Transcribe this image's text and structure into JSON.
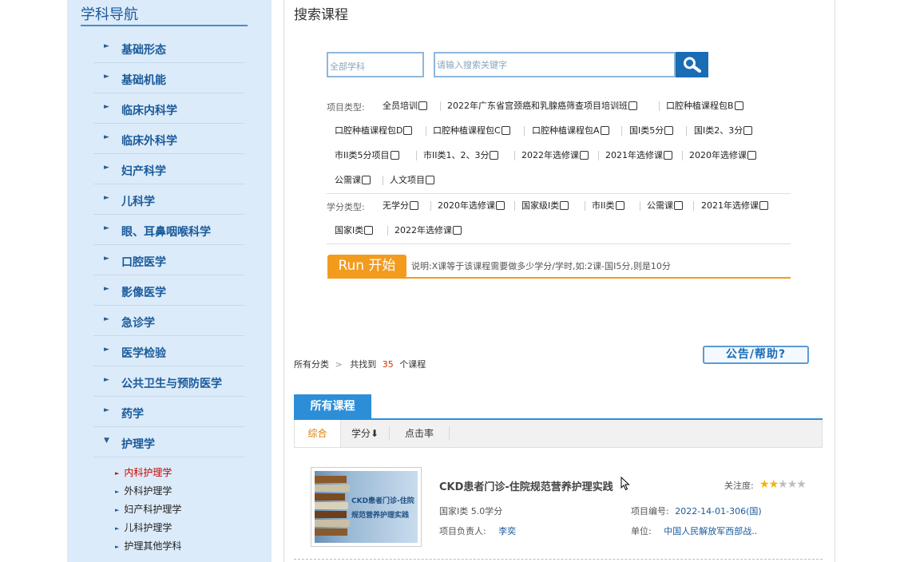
{
  "sidebar": {
    "title": "学科导航",
    "categories": [
      {
        "label": "基础形态",
        "arrow": "►"
      },
      {
        "label": "基础机能",
        "arrow": "►"
      },
      {
        "label": "临床内科学",
        "arrow": "►"
      },
      {
        "label": "临床外科学",
        "arrow": "►"
      },
      {
        "label": "妇产科学",
        "arrow": "►"
      },
      {
        "label": "儿科学",
        "arrow": "►"
      },
      {
        "label": "眼、耳鼻咽喉科学",
        "arrow": "►"
      },
      {
        "label": "口腔医学",
        "arrow": "►"
      },
      {
        "label": "影像医学",
        "arrow": "►"
      },
      {
        "label": "急诊学",
        "arrow": "►"
      },
      {
        "label": "医学检验",
        "arrow": "►"
      },
      {
        "label": "公共卫生与预防医学",
        "arrow": "►"
      },
      {
        "label": "药学",
        "arrow": "►"
      },
      {
        "label": "护理学",
        "arrow": "▼"
      }
    ],
    "subitems": [
      {
        "label": "内科护理学",
        "active": true
      },
      {
        "label": "外科护理学",
        "active": false
      },
      {
        "label": "妇产科护理学",
        "active": false
      },
      {
        "label": "儿科护理学",
        "active": false
      },
      {
        "label": "护理其他学科",
        "active": false
      }
    ],
    "sub_arrow": "►"
  },
  "search": {
    "title": "搜索课程",
    "subject_select": "全部学科",
    "placeholder": "请输入搜索关键字",
    "value": ""
  },
  "filters": {
    "project_label": "项目类型:",
    "project_options": [
      "全员培训",
      "2022年广东省宫颈癌和乳腺癌筛查项目培训班",
      "口腔种植课程包B",
      "口腔种植课程包D",
      "口腔种植课程包C",
      "口腔种植课程包A",
      "国I类5分",
      "国I类2、3分",
      "市II类5分项目",
      "市II类1、2、3分",
      "2022年选修课",
      "2021年选修课",
      "2020年选修课",
      "公需课",
      "人文项目"
    ],
    "credit_label": "学分类型:",
    "credit_options": [
      "无学分",
      "2020年选修课",
      "国家级I类",
      "市II类",
      "公需课",
      "2021年选修课",
      "国家I类",
      "2022年选修课"
    ]
  },
  "run": {
    "label": "Run 开始",
    "note": "说明:X课等于该课程需要做多少学分/学时,如:2课-国I5分,则是10分"
  },
  "results": {
    "crumb": "所有分类",
    "crumb_arrow": ">",
    "found_prefix": "共找到",
    "count": "35",
    "found_suffix": "个课程",
    "notice_button": "公告/帮助?"
  },
  "tabs": {
    "all": "所有课程",
    "sort": [
      "综合",
      "学分⬇",
      "点击率"
    ]
  },
  "course": {
    "title": "CKD患者门诊-住院规范营养护理实践",
    "thumb_line1": "CKD患者门诊-住院",
    "thumb_line2": "规范营养护理实践",
    "attention_label": "关注度:",
    "stars": [
      "★",
      "★",
      "★",
      "★",
      "★"
    ],
    "rating": 2,
    "type": "国家I类 5.0学分",
    "project_no_label": "项目编号:",
    "project_no": "2022-14-01-306(国)",
    "leader_label": "项目负责人:",
    "leader": "李奕",
    "unit_label": "单位:",
    "unit": "中国人民解放军西部战.."
  },
  "colors": {
    "sidebar_bg": "#dcebf9",
    "accent_blue": "#2d8ed8",
    "accent_orange": "#f39b1d",
    "active_red": "#cc0000",
    "star_gold": "#f0b400"
  }
}
